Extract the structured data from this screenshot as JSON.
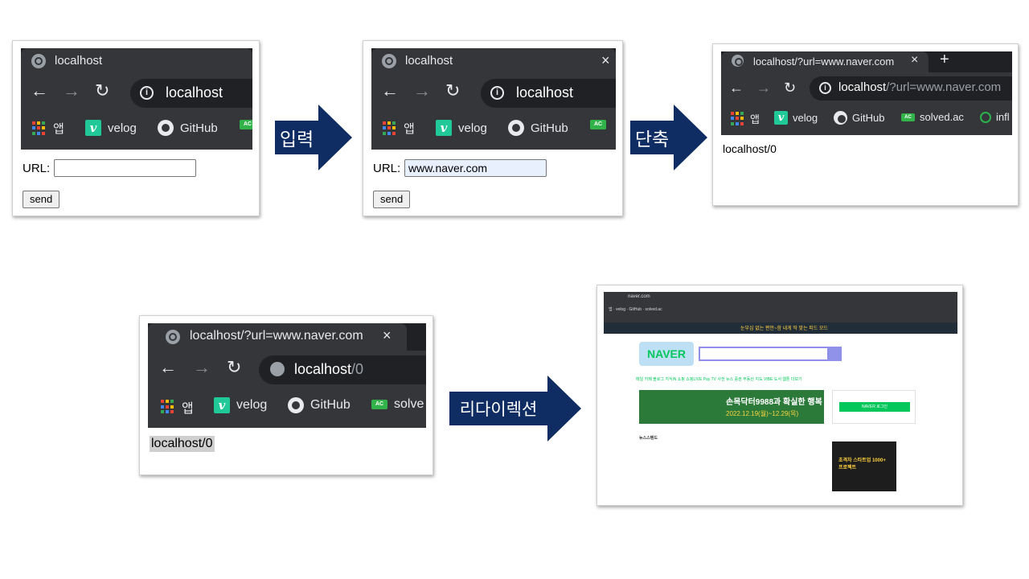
{
  "colors": {
    "arrow": "#0f2d63",
    "chrome_dark": "#35363a",
    "tabbar": "#202124",
    "velog": "#20c997",
    "solved_ac": "#32b349",
    "naver_green": "#03c75a"
  },
  "panel1": {
    "tab_title": "localhost",
    "address": "localhost",
    "bookmarks": {
      "apps": "앱",
      "velog": "velog",
      "github": "GitHub"
    },
    "form": {
      "label": "URL:",
      "input_value": "",
      "send": "send"
    }
  },
  "arrow1": {
    "label": "입력"
  },
  "panel2": {
    "tab_title": "localhost",
    "tab_close": "×",
    "address": "localhost",
    "bookmarks": {
      "apps": "앱",
      "velog": "velog",
      "github": "GitHub"
    },
    "form": {
      "label": "URL:",
      "input_value": "www.naver.com",
      "send": "send"
    }
  },
  "arrow2": {
    "label": "단축"
  },
  "panel3": {
    "tab_title": "localhost/?url=www.naver.com",
    "tab_close": "×",
    "new_tab": "+",
    "address_host": "localhost",
    "address_path": "/?url=www.naver.com",
    "bookmarks": {
      "apps": "앱",
      "velog": "velog",
      "github": "GitHub",
      "solved": "solved.ac",
      "infl": "infl"
    },
    "result": "localhost/0"
  },
  "panel4": {
    "tab_title": "localhost/?url=www.naver.com",
    "tab_close": "×",
    "address_host": "localhost",
    "address_path": "/0",
    "bookmarks": {
      "apps": "앱",
      "velog": "velog",
      "github": "GitHub",
      "solved": "solve"
    },
    "result": "localhost/0"
  },
  "arrow3": {
    "label": "리다이렉션"
  },
  "naver_shot": {
    "address": "naver.com",
    "logo": "NAVER",
    "whale_text": "눈부심 없는 편안~함 내게 딱 맞는 피드 모드",
    "banner_title": "손목닥터9988과 확실한 행복",
    "banner_dates": "2022.12.19(월)~12.29(목)",
    "login_button": "NAVER 로그인",
    "ad_text": "초격차 스타트업 1000+ 프로젝트",
    "menu": "메일 카페 블로그 지식iN 쇼핑 쇼핑LIVE Pay TV 사전 뉴스 증권 부동산 지도 VIBE 도서 웹툰 더보기",
    "news_label": "뉴스스탠드"
  }
}
